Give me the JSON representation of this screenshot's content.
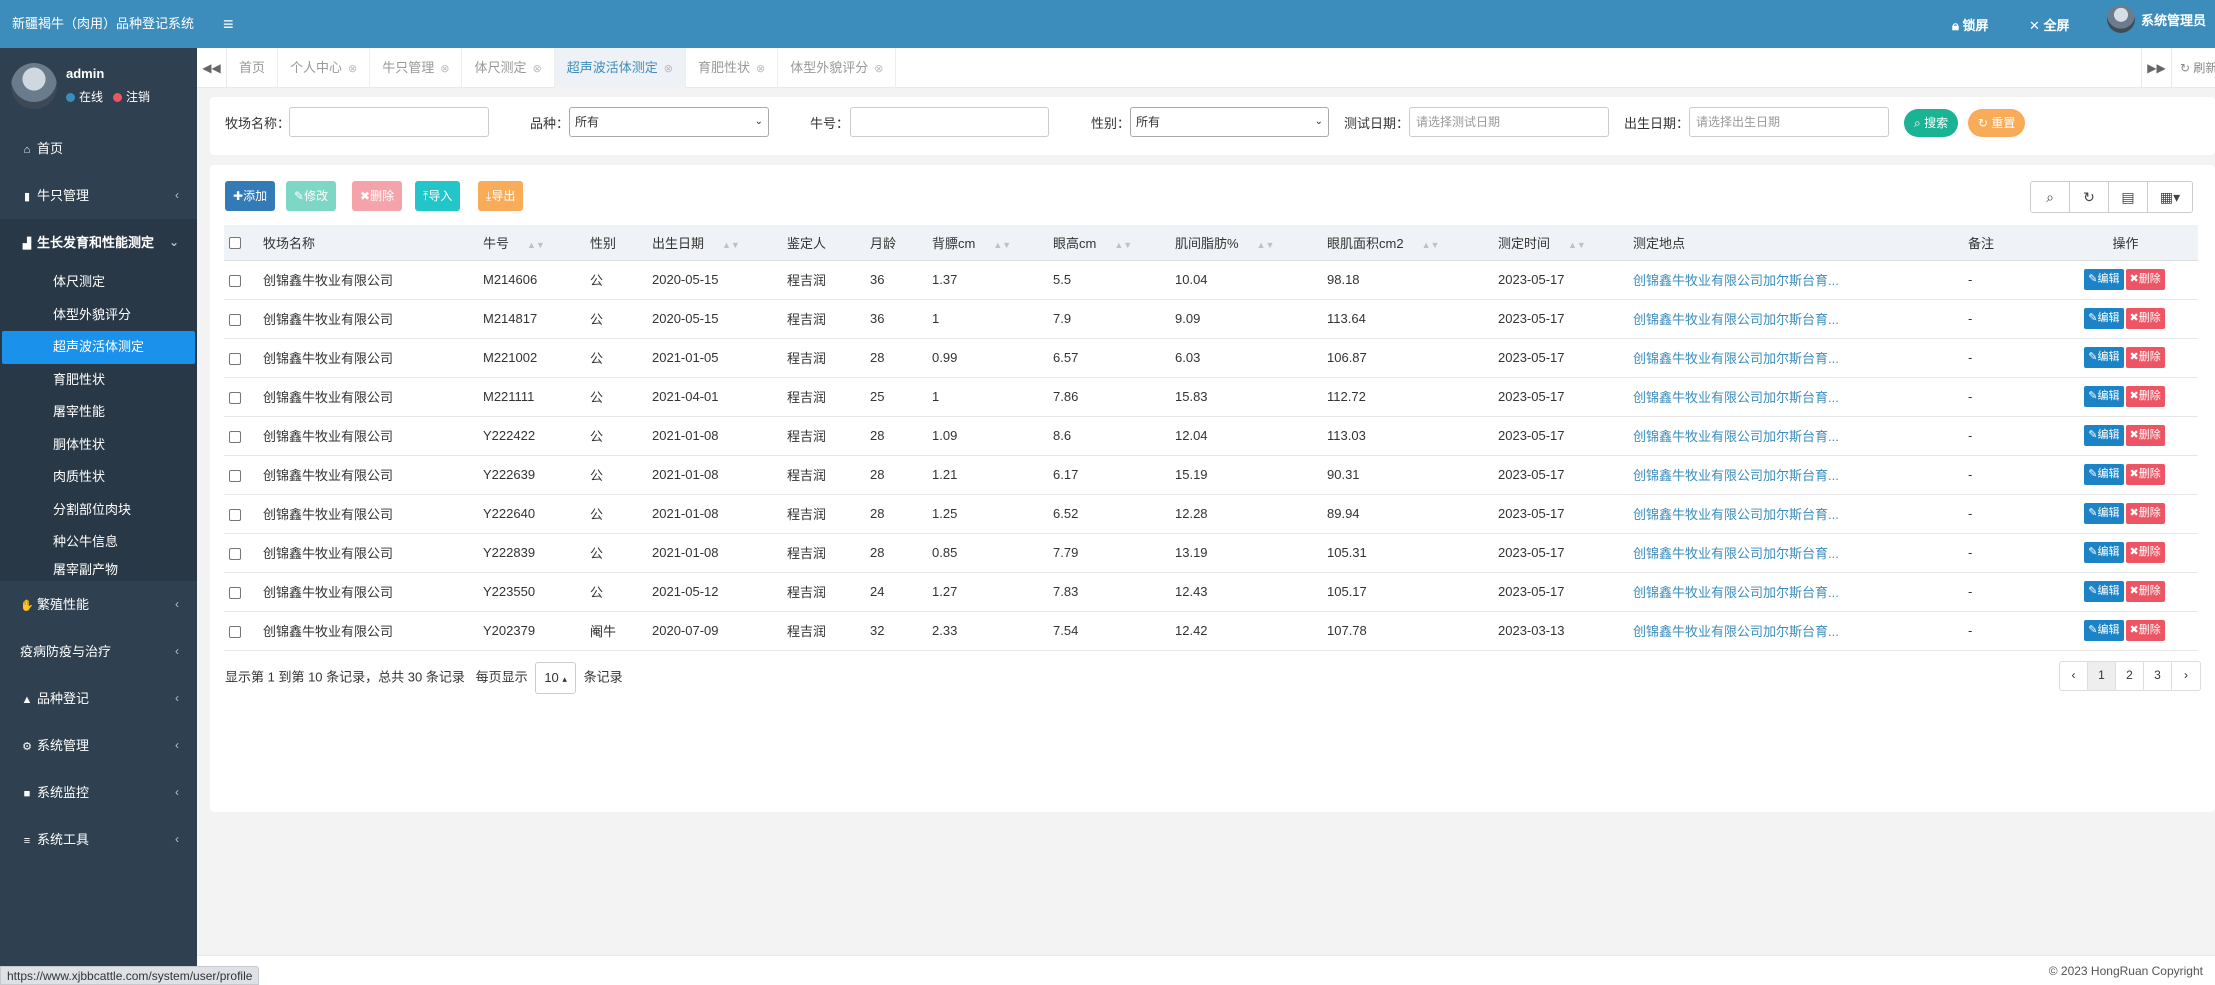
{
  "app": {
    "title": "新疆褐牛（肉用）品种登记系统",
    "user": {
      "name": "admin",
      "online": "在线",
      "logout": "注销"
    },
    "colors": {
      "header": "#3c8dbc",
      "sidebar": "#2f4050",
      "active": "#1a91eb",
      "primary": "#337ab7",
      "success": "#1ab394",
      "danger": "#ed5565",
      "warning": "#f8ac59",
      "info": "#23c6c8"
    }
  },
  "topbar": {
    "lock": "锁屏",
    "fullscreen": "全屏",
    "admin": "系统管理员"
  },
  "sidebar": {
    "items": [
      {
        "label": "首页",
        "icon": "home-icon"
      },
      {
        "label": "牛只管理",
        "icon": "book-icon"
      },
      {
        "label": "生长发育和性能测定",
        "icon": "area-chart-icon"
      },
      {
        "label": "繁殖性能",
        "icon": "hand-icon"
      },
      {
        "label": "疫病防疫与治疗",
        "icon": ""
      },
      {
        "label": "品种登记",
        "icon": "graduation-cap-icon"
      },
      {
        "label": "系统管理",
        "icon": "gear-icon"
      },
      {
        "label": "系统监控",
        "icon": "video-icon"
      },
      {
        "label": "系统工具",
        "icon": "bars-icon"
      }
    ],
    "sub": [
      "体尺测定",
      "体型外貌评分",
      "超声波活体测定",
      "育肥性状",
      "屠宰性能",
      "胴体性状",
      "肉质性状",
      "分割部位肉块",
      "种公牛信息",
      "屠宰副产物"
    ]
  },
  "tabs": [
    "首页",
    "个人中心",
    "牛只管理",
    "体尺测定",
    "超声波活体测定",
    "育肥性状",
    "体型外貌评分"
  ],
  "refresh_tab": "刷新",
  "search": {
    "farm_label": "牧场名称：",
    "breed_label": "品种：",
    "breed_value": "所有",
    "cow_label": "牛号：",
    "sex_label": "性别：",
    "sex_value": "所有",
    "test_date_label": "测试日期：",
    "test_date_placeholder": "请选择测试日期",
    "birth_date_label": "出生日期：",
    "birth_date_placeholder": "请选择出生日期",
    "search_btn": "搜索",
    "reset_btn": "重置"
  },
  "toolbar": {
    "add": "添加",
    "edit": "修改",
    "delete": "删除",
    "import": "导入",
    "export": "导出"
  },
  "table": {
    "headers": [
      "牧场名称",
      "牛号",
      "性别",
      "出生日期",
      "鉴定人",
      "月龄",
      "背膘cm",
      "眼高cm",
      "肌间脂肪%",
      "眼肌面积cm2",
      "测定时间",
      "测定地点",
      "备注",
      "操作"
    ],
    "edit_label": "编辑",
    "delete_label": "删除",
    "rows": [
      [
        "创锦鑫牛牧业有限公司",
        "M214606",
        "公",
        "2020-05-15",
        "程吉润",
        "36",
        "1.37",
        "5.5",
        "10.04",
        "98.18",
        "2023-05-17",
        "创锦鑫牛牧业有限公司加尔斯台育...",
        "-"
      ],
      [
        "创锦鑫牛牧业有限公司",
        "M214817",
        "公",
        "2020-05-15",
        "程吉润",
        "36",
        "1",
        "7.9",
        "9.09",
        "113.64",
        "2023-05-17",
        "创锦鑫牛牧业有限公司加尔斯台育...",
        "-"
      ],
      [
        "创锦鑫牛牧业有限公司",
        "M221002",
        "公",
        "2021-01-05",
        "程吉润",
        "28",
        "0.99",
        "6.57",
        "6.03",
        "106.87",
        "2023-05-17",
        "创锦鑫牛牧业有限公司加尔斯台育...",
        "-"
      ],
      [
        "创锦鑫牛牧业有限公司",
        "M221111",
        "公",
        "2021-04-01",
        "程吉润",
        "25",
        "1",
        "7.86",
        "15.83",
        "112.72",
        "2023-05-17",
        "创锦鑫牛牧业有限公司加尔斯台育...",
        "-"
      ],
      [
        "创锦鑫牛牧业有限公司",
        "Y222422",
        "公",
        "2021-01-08",
        "程吉润",
        "28",
        "1.09",
        "8.6",
        "12.04",
        "113.03",
        "2023-05-17",
        "创锦鑫牛牧业有限公司加尔斯台育...",
        "-"
      ],
      [
        "创锦鑫牛牧业有限公司",
        "Y222639",
        "公",
        "2021-01-08",
        "程吉润",
        "28",
        "1.21",
        "6.17",
        "15.19",
        "90.31",
        "2023-05-17",
        "创锦鑫牛牧业有限公司加尔斯台育...",
        "-"
      ],
      [
        "创锦鑫牛牧业有限公司",
        "Y222640",
        "公",
        "2021-01-08",
        "程吉润",
        "28",
        "1.25",
        "6.52",
        "12.28",
        "89.94",
        "2023-05-17",
        "创锦鑫牛牧业有限公司加尔斯台育...",
        "-"
      ],
      [
        "创锦鑫牛牧业有限公司",
        "Y222839",
        "公",
        "2021-01-08",
        "程吉润",
        "28",
        "0.85",
        "7.79",
        "13.19",
        "105.31",
        "2023-05-17",
        "创锦鑫牛牧业有限公司加尔斯台育...",
        "-"
      ],
      [
        "创锦鑫牛牧业有限公司",
        "Y223550",
        "公",
        "2021-05-12",
        "程吉润",
        "24",
        "1.27",
        "7.83",
        "12.43",
        "105.17",
        "2023-05-17",
        "创锦鑫牛牧业有限公司加尔斯台育...",
        "-"
      ],
      [
        "创锦鑫牛牧业有限公司",
        "Y202379",
        "阉牛",
        "2020-07-09",
        "程吉润",
        "32",
        "2.33",
        "7.54",
        "12.42",
        "107.78",
        "2023-03-13",
        "创锦鑫牛牧业有限公司加尔斯台育...",
        "-"
      ]
    ]
  },
  "pagination": {
    "info": "显示第 1 到第 10 条记录，总共 30 条记录",
    "per_page_label": "每页显示",
    "per_page_value": "10",
    "records_label": "条记录",
    "pages": [
      "1",
      "2",
      "3"
    ]
  },
  "footer": {
    "copyright": "© 2023 HongRuan Copyright"
  },
  "status_url": "https://www.xjbbcattle.com/system/user/profile"
}
